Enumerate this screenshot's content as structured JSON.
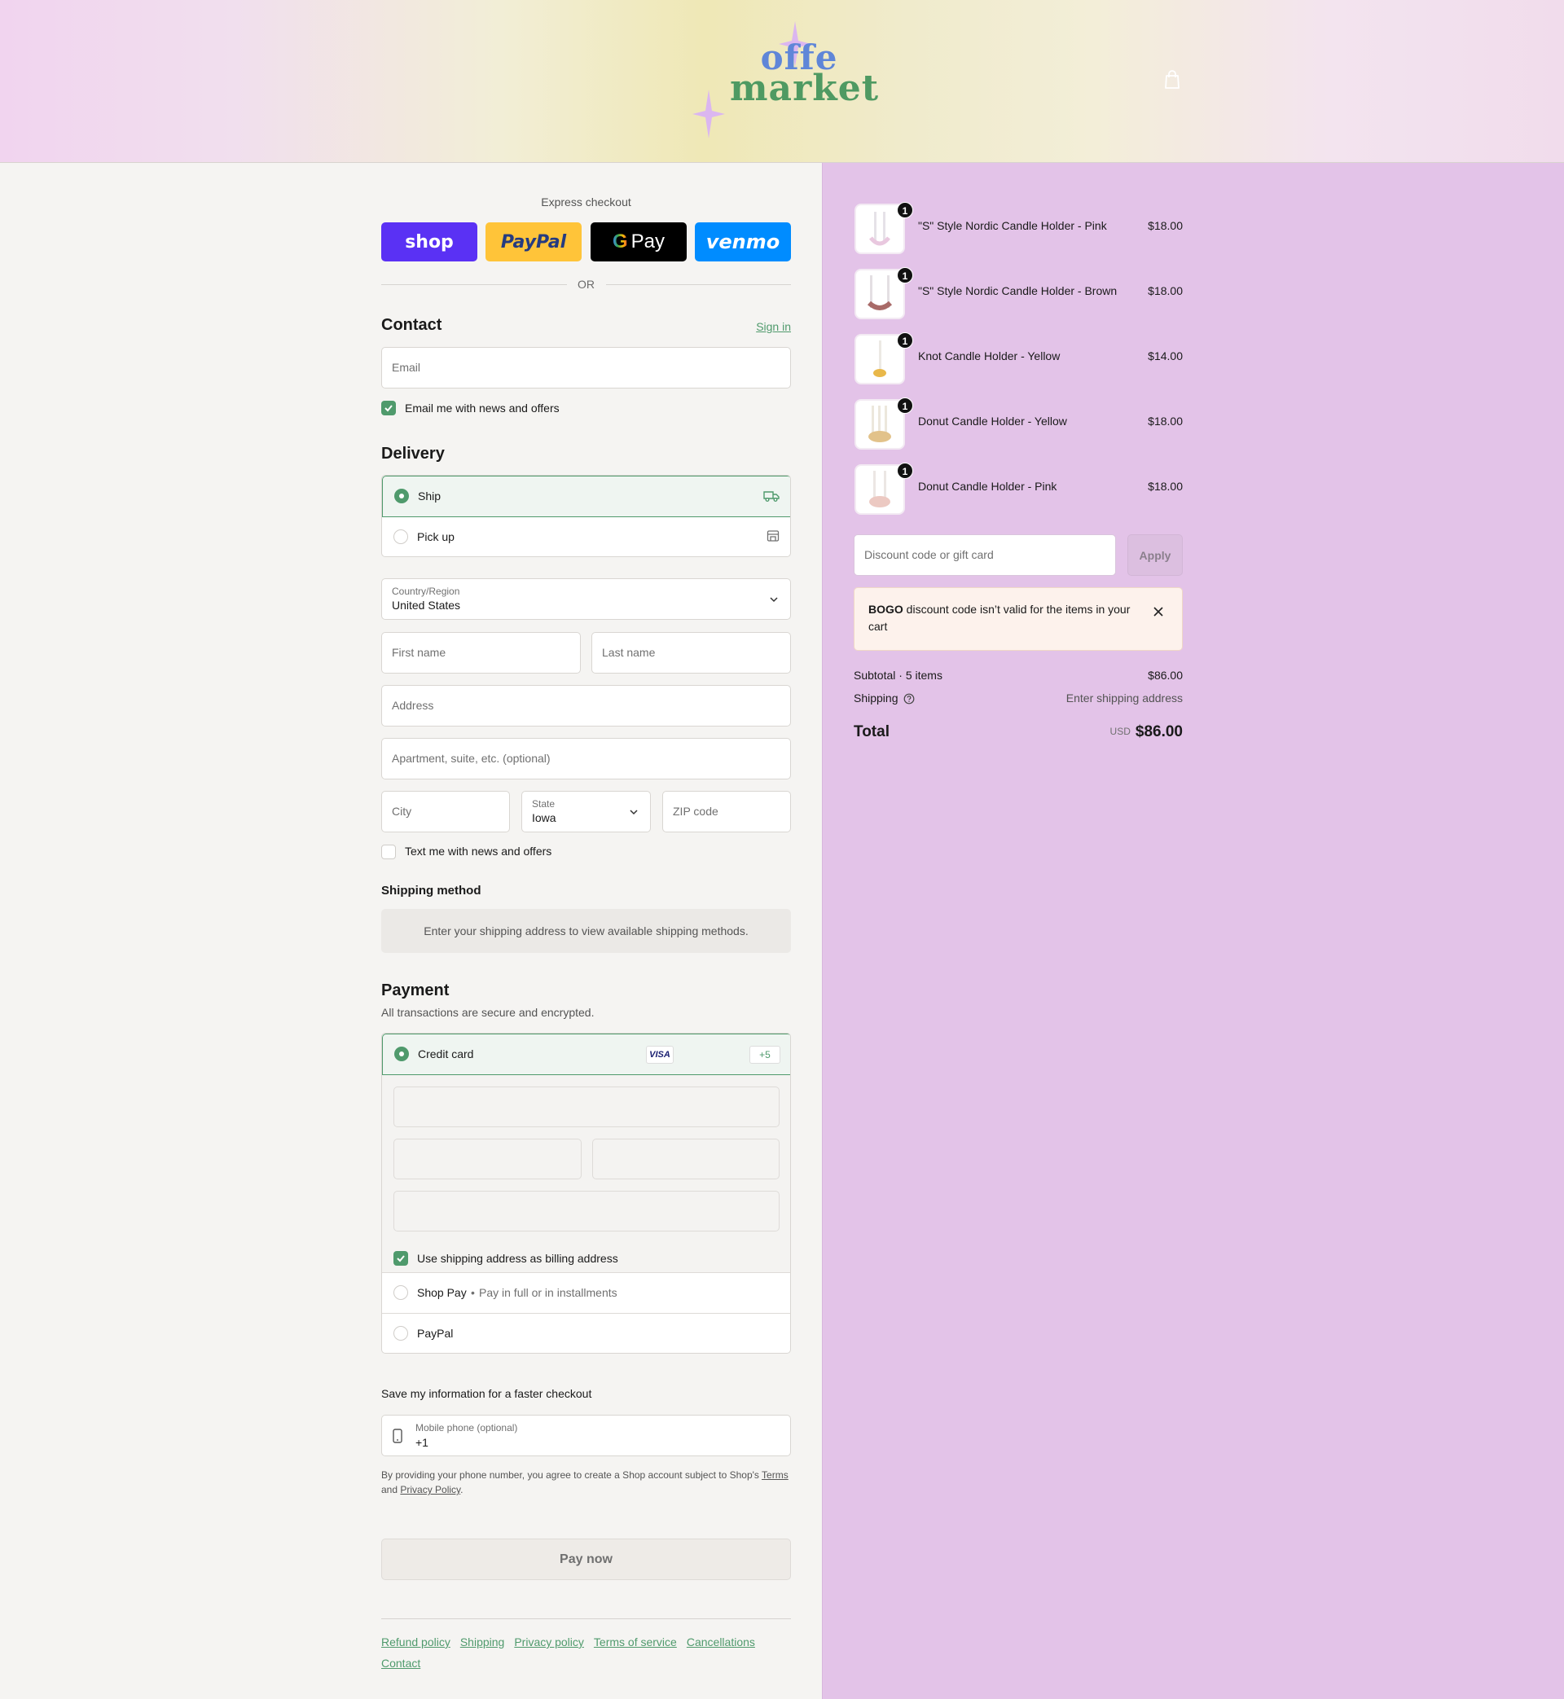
{
  "header": {
    "logo_line1": "offe",
    "logo_line2": "market",
    "colors": {
      "logo_blue": "#5f86d8",
      "logo_green": "#4f9a62",
      "sparkle": "#d9b4ee"
    }
  },
  "express": {
    "label": "Express checkout",
    "shop": "shop",
    "paypal": "PayPal",
    "gpay_g": "G",
    "gpay_text": "Pay",
    "venmo": "venmo",
    "or": "OR"
  },
  "contact": {
    "title": "Contact",
    "sign_in": "Sign in",
    "email_placeholder": "Email",
    "news_label": "Email me with news and offers"
  },
  "delivery": {
    "title": "Delivery",
    "ship": "Ship",
    "pickup": "Pick up",
    "country_label": "Country/Region",
    "country_value": "United States",
    "first_name": "First name",
    "last_name": "Last name",
    "address": "Address",
    "apartment": "Apartment, suite, etc. (optional)",
    "city": "City",
    "state_label": "State",
    "state_value": "Iowa",
    "zip": "ZIP code",
    "text_label": "Text me with news and offers"
  },
  "shipping_method": {
    "title": "Shipping method",
    "info": "Enter your shipping address to view available shipping methods."
  },
  "payment": {
    "title": "Payment",
    "subtitle": "All transactions are secure and encrypted.",
    "credit_card": "Credit card",
    "visa": "VISA",
    "more_cards": "+5",
    "billing_label": "Use shipping address as billing address",
    "shop_pay": "Shop Pay",
    "shop_pay_note": "Pay in full or in installments",
    "paypal": "PayPal"
  },
  "save_info": {
    "title": "Save my information for a faster checkout",
    "phone_label": "Mobile phone (optional)",
    "phone_value": "+1",
    "disclaimer_pre": "By providing your phone number, you agree to create a Shop account subject to Shop's",
    "terms": "Terms",
    "and": "and",
    "privacy": "Privacy Policy",
    "period": "."
  },
  "pay_now": "Pay now",
  "footer": {
    "links": [
      "Refund policy",
      "Shipping",
      "Privacy policy",
      "Terms of service",
      "Cancellations",
      "Contact"
    ]
  },
  "summary": {
    "items": [
      {
        "name": "\"S\" Style Nordic Candle Holder - Pink",
        "price": "$18.00",
        "qty": "1"
      },
      {
        "name": "\"S\" Style Nordic Candle Holder - Brown",
        "price": "$18.00",
        "qty": "1"
      },
      {
        "name": "Knot Candle Holder - Yellow",
        "price": "$14.00",
        "qty": "1"
      },
      {
        "name": "Donut Candle Holder - Yellow",
        "price": "$18.00",
        "qty": "1"
      },
      {
        "name": "Donut Candle Holder - Pink",
        "price": "$18.00",
        "qty": "1"
      }
    ],
    "discount_placeholder": "Discount code or gift card",
    "apply": "Apply",
    "alert_code": "BOGO",
    "alert_text": " discount code isn’t valid for the items in your cart",
    "subtotal_label": "Subtotal · 5 items",
    "subtotal_value": "$86.00",
    "shipping_label": "Shipping",
    "shipping_value": "Enter shipping address",
    "total_label": "Total",
    "currency": "USD",
    "total_value": "$86.00"
  },
  "colors": {
    "accent": "#4f9a6c",
    "shop_purple": "#5a31f4",
    "paypal_yellow": "#ffc439",
    "venmo_blue": "#008cff",
    "sidebar_bg": "#e3c3e8"
  }
}
